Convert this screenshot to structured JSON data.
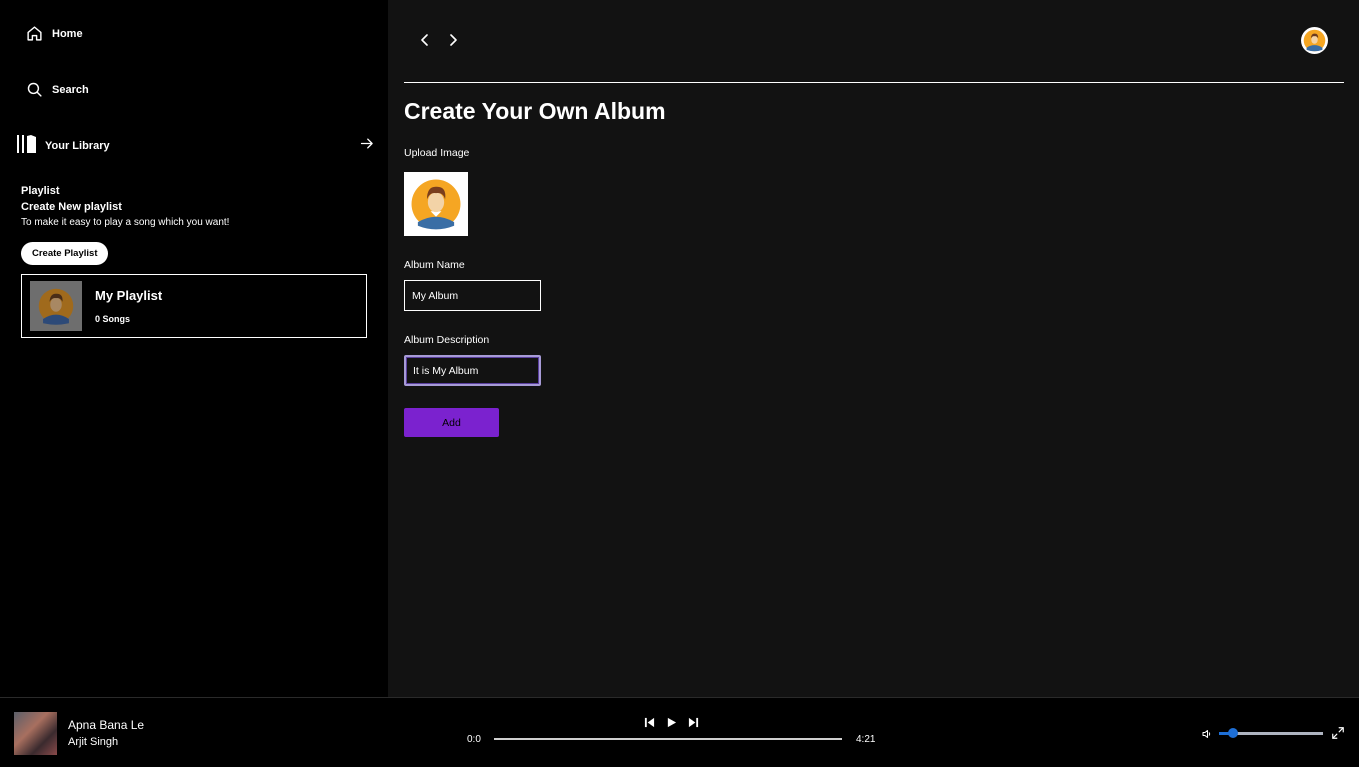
{
  "sidebar": {
    "home_label": "Home",
    "search_label": "Search",
    "library_label": "Your Library",
    "playlist_heading": "Playlist",
    "create_new_label": "Create New playlist",
    "create_desc": "To make it easy to play a song which you want!",
    "create_button": "Create Playlist",
    "playlists": [
      {
        "name": "My Playlist",
        "count": "0 Songs"
      }
    ]
  },
  "main": {
    "title": "Create Your Own Album",
    "upload_label": "Upload Image",
    "album_name_label": "Album Name",
    "album_name_value": "My Album",
    "album_desc_label": "Album Description",
    "album_desc_value": "It is My Album",
    "add_button": "Add"
  },
  "player": {
    "track_title": "Apna Bana Le",
    "artist": "Arjit Singh",
    "current_time": "0:0",
    "duration": "4:21",
    "progress": 0,
    "volume": 0.13
  },
  "colors": {
    "accent": "#7b22cf",
    "volume": "#1e6fd6",
    "main_bg": "#121212",
    "sidebar_bg": "#000000"
  },
  "icons": [
    "home-icon",
    "search-icon",
    "library-icon",
    "arrow-right-icon",
    "chevron-left-icon",
    "chevron-right-icon",
    "avatar",
    "previous-icon",
    "play-icon",
    "next-icon",
    "volume-icon",
    "fullscreen-icon"
  ]
}
